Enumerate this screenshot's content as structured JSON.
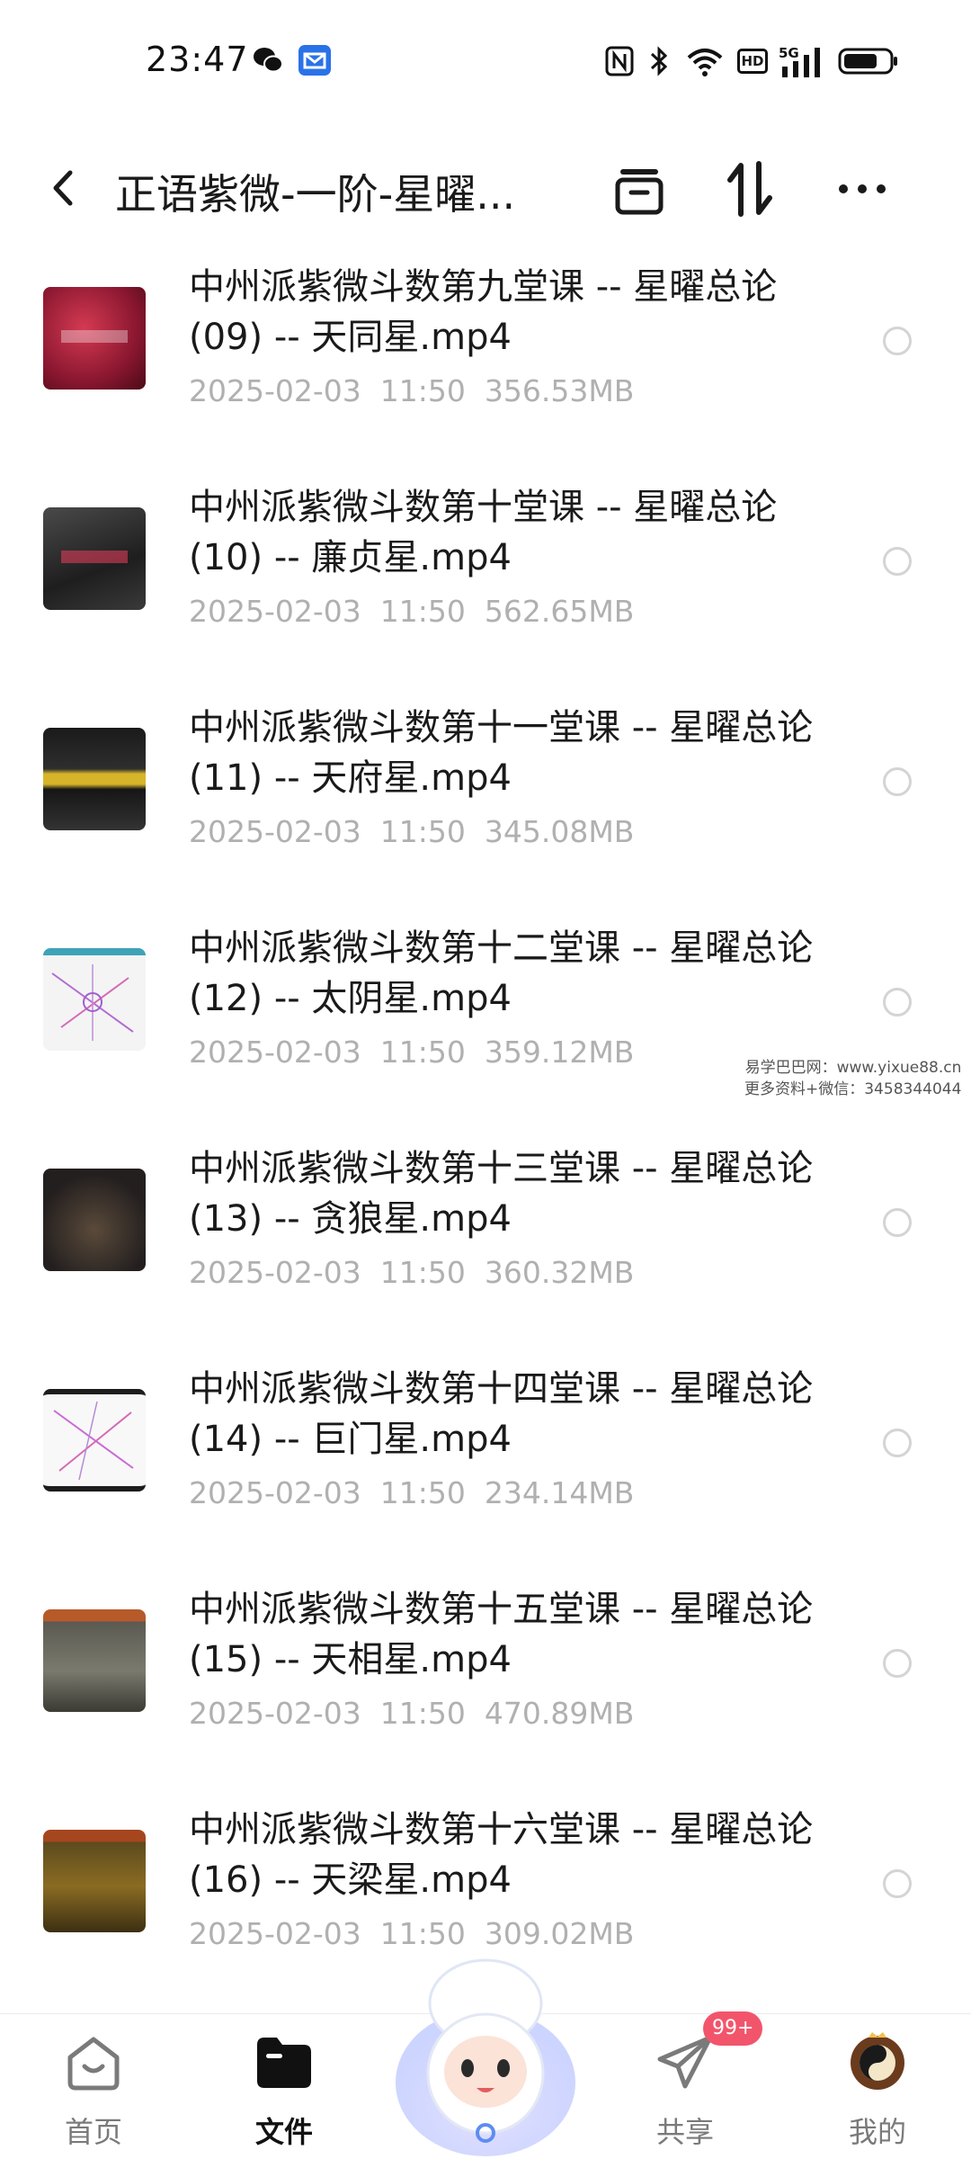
{
  "status_bar": {
    "time": "23:47",
    "icons": [
      "wechat-icon",
      "mail-app-icon",
      "nfc-icon",
      "bluetooth-icon",
      "wifi-icon",
      "hd-icon",
      "5g-signal-icon",
      "battery-icon"
    ],
    "hd_label": "HD"
  },
  "header": {
    "title": "正语紫微-一阶-星曜...",
    "icons": [
      "back-icon",
      "archive-icon",
      "sort-icon",
      "more-icon"
    ]
  },
  "files": [
    {
      "name": "中州派紫微斗数第九堂课 -- 星曜总论(09) -- 天同星.mp4",
      "date": "2025-02-03",
      "time": "11:50",
      "size": "356.53MB"
    },
    {
      "name": "中州派紫微斗数第十堂课 -- 星曜总论(10) -- 廉贞星.mp4",
      "date": "2025-02-03",
      "time": "11:50",
      "size": "562.65MB"
    },
    {
      "name": "中州派紫微斗数第十一堂课 -- 星曜总论(11) -- 天府星.mp4",
      "date": "2025-02-03",
      "time": "11:50",
      "size": "345.08MB"
    },
    {
      "name": "中州派紫微斗数第十二堂课 -- 星曜总论(12) -- 太阴星.mp4",
      "date": "2025-02-03",
      "time": "11:50",
      "size": "359.12MB"
    },
    {
      "name": "中州派紫微斗数第十三堂课 -- 星曜总论(13) -- 贪狼星.mp4",
      "date": "2025-02-03",
      "time": "11:50",
      "size": "360.32MB"
    },
    {
      "name": "中州派紫微斗数第十四堂课 -- 星曜总论(14) -- 巨门星.mp4",
      "date": "2025-02-03",
      "time": "11:50",
      "size": "234.14MB"
    },
    {
      "name": "中州派紫微斗数第十五堂课 -- 星曜总论(15) -- 天相星.mp4",
      "date": "2025-02-03",
      "time": "11:50",
      "size": "470.89MB"
    },
    {
      "name": "中州派紫微斗数第十六堂课 -- 星曜总论(16) -- 天梁星.mp4",
      "date": "2025-02-03",
      "time": "11:50",
      "size": "309.02MB"
    }
  ],
  "watermark": {
    "line1": "易学巴巴网：www.yixue88.cn",
    "line2": "更多资料+微信：3458344044"
  },
  "bottom_nav": {
    "home": "首页",
    "files": "文件",
    "share": "共享",
    "mine": "我的",
    "share_badge": "99+"
  },
  "colors": {
    "badge": "#f2556b",
    "meta_text": "#b0b0b0",
    "mail_app": "#2a72e8"
  }
}
